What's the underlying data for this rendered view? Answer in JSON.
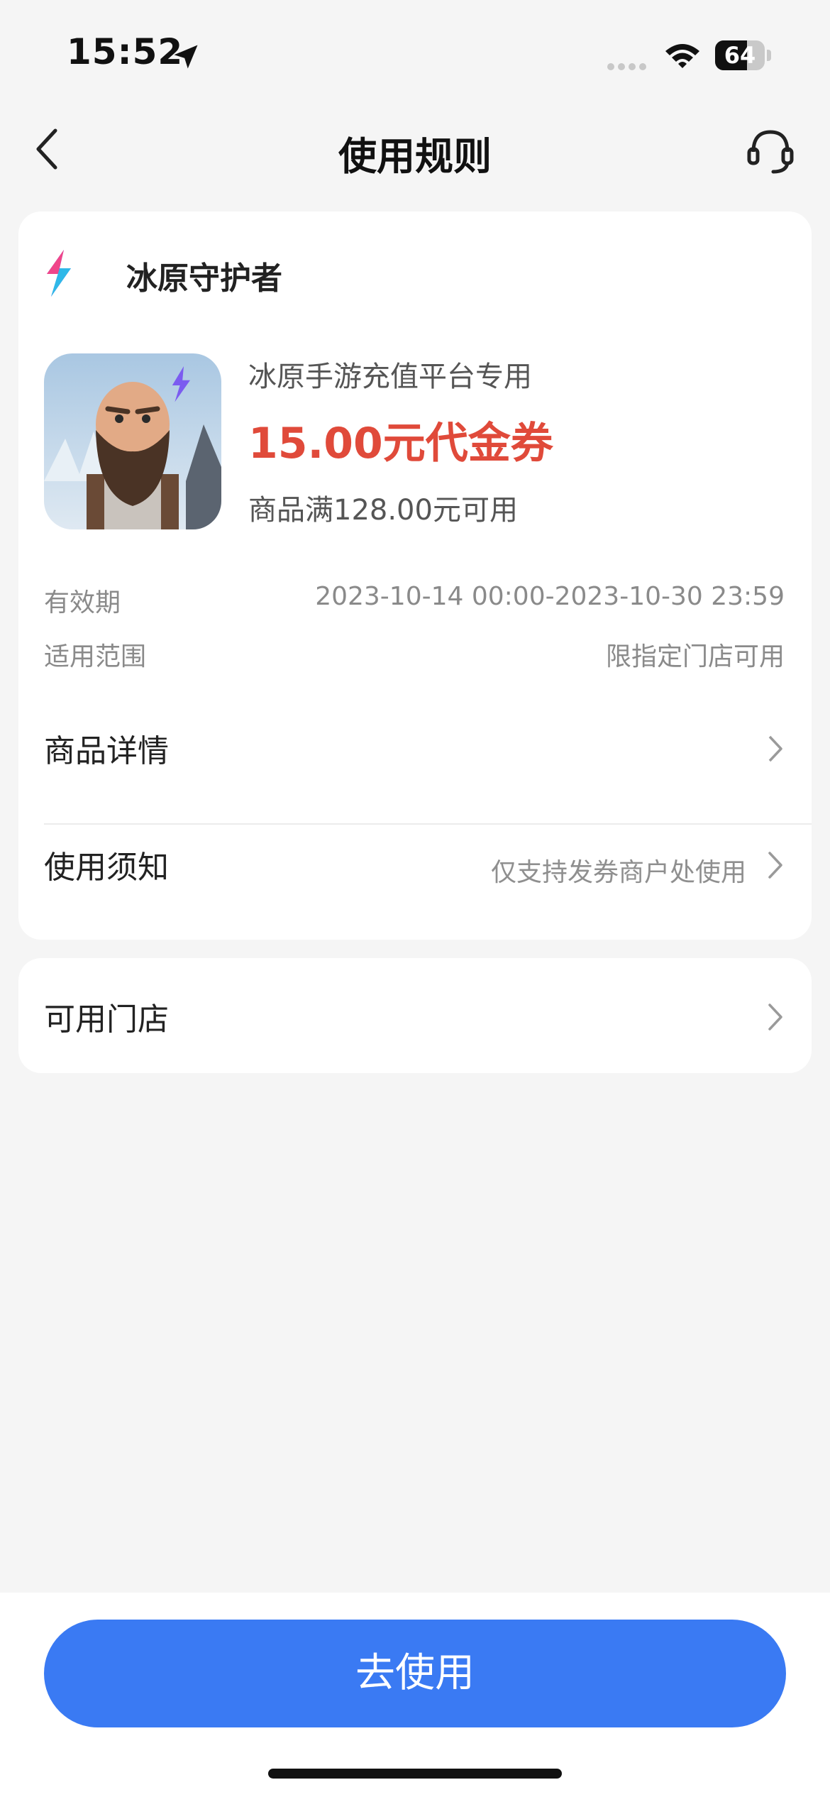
{
  "status_bar": {
    "time": "15:52",
    "battery_level": "64",
    "battery_fraction": 0.64,
    "icons": [
      "location-arrow-icon",
      "signal-dots-icon",
      "wifi-icon",
      "battery-icon"
    ]
  },
  "nav": {
    "title": "使用规则",
    "icons": [
      "back-chevron-icon",
      "customer-service-headset-icon"
    ]
  },
  "merchant": {
    "name": "冰原守护者",
    "logo": "lightning-bolt-logo"
  },
  "coupon": {
    "thumbnail": "bearded-warrior-game-art",
    "subtitle": "冰原手游充值平台专用",
    "amount": "15.00元代金券",
    "condition": "商品满128.00元可用",
    "amount_color": "#e04a3a"
  },
  "info": {
    "validity_label": "有效期",
    "validity_value": "2023-10-14 00:00-2023-10-30 23:59",
    "scope_label": "适用范围",
    "scope_value": "限指定门店可用"
  },
  "rows": {
    "product_details": {
      "label": "商品详情"
    },
    "usage_notice": {
      "label": "使用须知",
      "hint": "仅支持发券商户处使用"
    },
    "stores": {
      "label": "可用门店"
    }
  },
  "bottom": {
    "use_button": "去使用",
    "button_color": "#3a7af3"
  }
}
